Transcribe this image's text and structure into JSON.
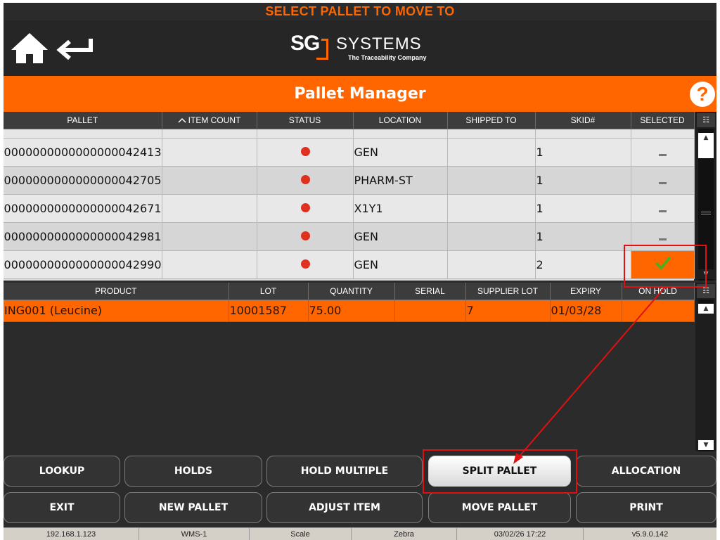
{
  "instruction": "SELECT PALLET TO MOVE TO",
  "header": {
    "logo_sg": "SG",
    "logo_systems": "SYSTEMS",
    "logo_tagline": "The Traceability Company",
    "home_icon": "home-icon",
    "back_icon": "back-arrow-icon"
  },
  "title": "Pallet Manager",
  "help_label": "?",
  "pallet_table": {
    "columns": [
      "PALLET",
      "ITEM COUNT",
      "STATUS",
      "LOCATION",
      "SHIPPED TO",
      "SKID#",
      "SELECTED"
    ],
    "sort_indicator": "ascending",
    "rows": [
      {
        "pallet": "0000000000000000042413",
        "item_count": "",
        "status": "red",
        "location": "GEN",
        "shipped_to": "",
        "skid": "1",
        "selected": false
      },
      {
        "pallet": "0000000000000000042705",
        "item_count": "",
        "status": "red",
        "location": "PHARM-ST",
        "shipped_to": "",
        "skid": "1",
        "selected": false
      },
      {
        "pallet": "0000000000000000042671",
        "item_count": "",
        "status": "red",
        "location": "X1Y1",
        "shipped_to": "",
        "skid": "1",
        "selected": false
      },
      {
        "pallet": "0000000000000000042981",
        "item_count": "",
        "status": "red",
        "location": "GEN",
        "shipped_to": "",
        "skid": "1",
        "selected": false
      },
      {
        "pallet": "0000000000000000042990",
        "item_count": "",
        "status": "red",
        "location": "GEN",
        "shipped_to": "",
        "skid": "2",
        "selected": true
      }
    ]
  },
  "product_table": {
    "columns": [
      "PRODUCT",
      "LOT",
      "QUANTITY",
      "SERIAL",
      "SUPPLIER LOT",
      "EXPIRY",
      "ON HOLD"
    ],
    "rows": [
      {
        "product": "ING001 (Leucine)",
        "lot": "10001587",
        "quantity": "75.00",
        "serial": "",
        "supplier_lot": "7",
        "expiry": "01/03/28",
        "on_hold": ""
      }
    ]
  },
  "buttons": {
    "row1": [
      "LOOKUP",
      "HOLDS",
      "HOLD MULTIPLE",
      "SPLIT PALLET",
      "ALLOCATION"
    ],
    "row2": [
      "EXIT",
      "NEW PALLET",
      "ADJUST ITEM",
      "MOVE PALLET",
      "PRINT"
    ],
    "active": "SPLIT PALLET"
  },
  "status_bar": [
    "192.168.1.123",
    "WMS-1",
    "Scale",
    "Zebra",
    "03/02/26 17:22",
    "v5.9.0.142"
  ],
  "colors": {
    "accent": "#ff6600",
    "background": "#2b2b2b",
    "status_red": "#e03020",
    "check_green": "#4caf1e",
    "annotation_red": "#e01010"
  }
}
